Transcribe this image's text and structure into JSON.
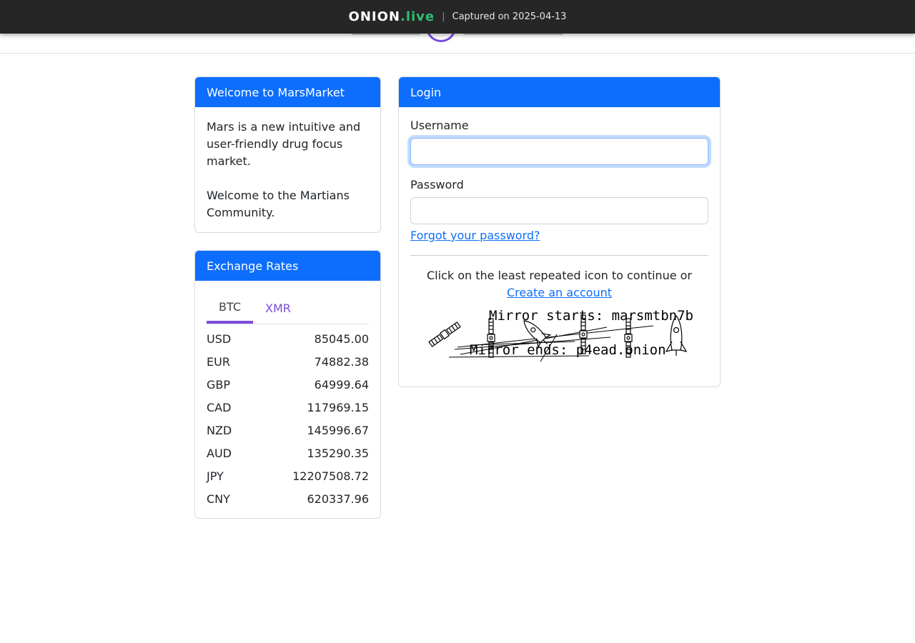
{
  "capture_bar": {
    "brand_main": "ONION",
    "brand_tld": ".live",
    "separator": "|",
    "captured": "Captured on 2025-04-13"
  },
  "welcome": {
    "title": "Welcome to MarsMarket",
    "paragraph1": "Mars is a new intuitive and user-friendly drug focus market.",
    "paragraph2": "Welcome to the Martians Community."
  },
  "exchange": {
    "title": "Exchange Rates",
    "tabs": [
      "BTC",
      "XMR"
    ],
    "active_tab": "BTC",
    "rates": [
      {
        "currency": "USD",
        "value": "85045.00"
      },
      {
        "currency": "EUR",
        "value": "74882.38"
      },
      {
        "currency": "GBP",
        "value": "64999.64"
      },
      {
        "currency": "CAD",
        "value": "117969.15"
      },
      {
        "currency": "NZD",
        "value": "145996.67"
      },
      {
        "currency": "AUD",
        "value": "135290.35"
      },
      {
        "currency": "JPY",
        "value": "12207508.72"
      },
      {
        "currency": "CNY",
        "value": "620337.96"
      }
    ]
  },
  "login": {
    "title": "Login",
    "username_label": "Username",
    "username_value": "",
    "password_label": "Password",
    "password_value": "",
    "forgot_link": "Forgot your password?",
    "captcha_prompt": "Click on the least repeated icon to continue or",
    "create_account_link": "Create an account",
    "captcha_text_line1": "Mirror starts: marsmtbn7b",
    "captcha_text_line2": "Mirror ends: p4ead.onion",
    "captcha_icons": [
      "satellite-icon",
      "satellite-icon",
      "rocket-icon",
      "satellite-icon",
      "satellite-icon",
      "rocket-icon"
    ]
  },
  "colors": {
    "primary": "#0d6efd",
    "accent_purple": "#7c4ddb",
    "onion_green": "#2fbf71"
  }
}
